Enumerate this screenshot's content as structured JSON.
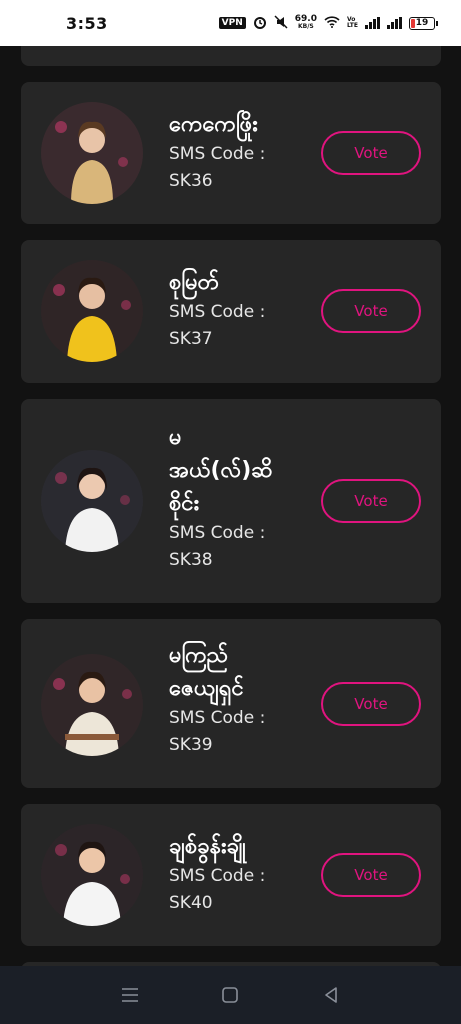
{
  "status_bar": {
    "time": "3:53",
    "vpn": "VPN",
    "speed_value": "69.0",
    "speed_unit": "KB/S",
    "volte_top": "Vo",
    "volte_bottom": "LTE",
    "battery": "19"
  },
  "colors": {
    "background": "#121212",
    "card": "#262626",
    "accent": "#e0147f",
    "nav_bar": "#1b1f27"
  },
  "contestants": [
    {
      "name": "ကေကေဖြိုး",
      "code_label": "SMS Code :",
      "code": "SK36",
      "vote_label": "Vote",
      "outfit_color": "#d9b67a"
    },
    {
      "name": "စုမြတ်",
      "code_label": "SMS Code :",
      "code": "SK37",
      "vote_label": "Vote",
      "outfit_color": "#f0c21c"
    },
    {
      "name": "မ\nအယ်(လ်)ဆိ\nစိုင်း",
      "code_label": "SMS Code :",
      "code": "SK38",
      "vote_label": "Vote",
      "outfit_color": "#f2f2f2"
    },
    {
      "name": "မကြည်\nဇေယျရှင်",
      "code_label": "SMS Code :",
      "code": "SK39",
      "vote_label": "Vote",
      "outfit_color": "#ede6d8"
    },
    {
      "name": "ချစ်ခွန်းချို",
      "code_label": "SMS Code :",
      "code": "SK40",
      "vote_label": "Vote",
      "outfit_color": "#f4f4f4"
    }
  ],
  "nav_bar": {
    "icons": [
      "menu-icon",
      "home-icon",
      "back-icon"
    ]
  }
}
